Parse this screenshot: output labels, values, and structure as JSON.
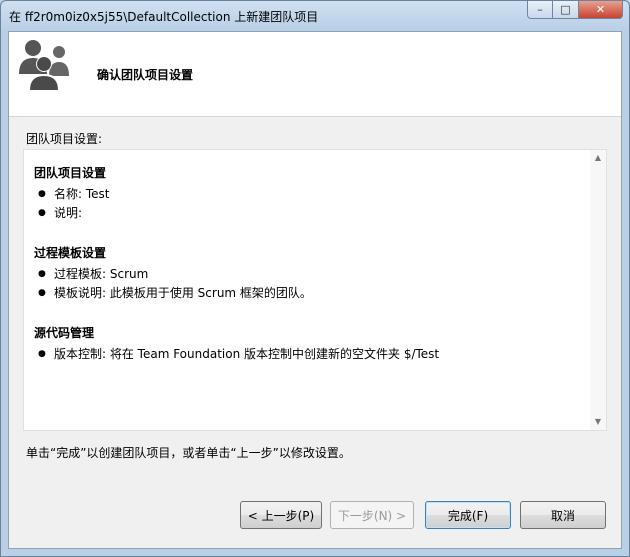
{
  "window": {
    "title": "在 ff2r0m0iz0x5j55\\DefaultCollection 上新建团队项目",
    "controls": {
      "minimize": "–",
      "maximize": "□",
      "close": "✕"
    }
  },
  "header": {
    "icon": "team-people-icon",
    "title": "确认团队项目设置"
  },
  "section_label": "团队项目设置:",
  "summary": {
    "groups": [
      {
        "title": "团队项目设置",
        "items": [
          "名称: Test",
          "说明:"
        ]
      },
      {
        "title": "过程模板设置",
        "items": [
          "过程模板: Scrum",
          "模板说明: 此模板用于使用 Scrum 框架的团队。"
        ]
      },
      {
        "title": "源代码管理",
        "items": [
          "版本控制: 将在 Team Foundation 版本控制中创建新的空文件夹 $/Test"
        ]
      }
    ],
    "bullet": "●"
  },
  "hint": "单击“完成”以创建团队项目，或者单击“上一步”以修改设置。",
  "buttons": {
    "previous": "< 上一步(P)",
    "next": "下一步(N) >",
    "finish": "完成(F)",
    "cancel": "取消"
  },
  "colors": {
    "title_bar": "#b9cfe6",
    "client_bg": "#f0f0f0",
    "close_button": "#c7432f"
  }
}
